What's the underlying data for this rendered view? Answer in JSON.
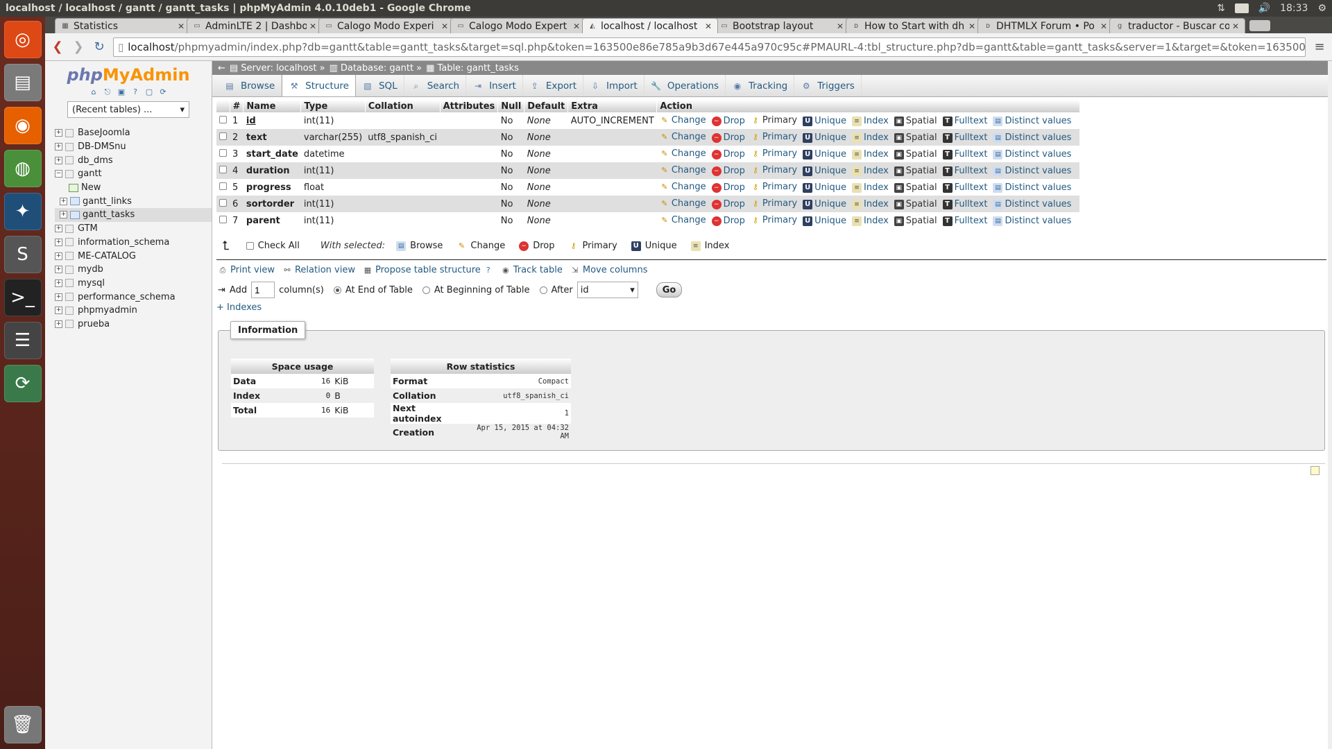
{
  "window_title": "localhost / localhost / gantt / gantt_tasks | phpMyAdmin 4.0.10deb1 - Google Chrome",
  "os_tray": {
    "keyboard": "Es",
    "time": "18:33"
  },
  "tabs": [
    {
      "label": "Statistics",
      "fav": "▦"
    },
    {
      "label": "AdminLTE 2 | Dashbo",
      "fav": "▭"
    },
    {
      "label": "Calogo Modo Experi",
      "fav": "▭"
    },
    {
      "label": "Calogo Modo Expert",
      "fav": "▭"
    },
    {
      "label": "localhost / localhost",
      "fav": "◭",
      "active": true
    },
    {
      "label": "Bootstrap layout",
      "fav": "▭"
    },
    {
      "label": "How to Start with dh",
      "fav": "ᴅ"
    },
    {
      "label": "DHTMLX Forum • Po",
      "fav": "ᴅ"
    },
    {
      "label": "traductor - Buscar co",
      "fav": "g"
    }
  ],
  "url": {
    "host": "localhost",
    "rest": "/phpmyadmin/index.php?db=gantt&table=gantt_tasks&target=sql.php&token=163500e86e785a9b3d67e445a970c95c#PMAURL-4:tbl_structure.php?db=gantt&table=gantt_tasks&server=1&target=&token=163500e86e785a9b3"
  },
  "logo": {
    "php": "php",
    "my": "My",
    "admin": "Admin"
  },
  "recent_tables": "(Recent tables) ...",
  "tree": {
    "dbs_before": [
      "BaseJoomla",
      "DB-DMSnu",
      "db_dms"
    ],
    "gantt": "gantt",
    "gantt_children": [
      "New",
      "gantt_links",
      "gantt_tasks"
    ],
    "dbs_after": [
      "GTM",
      "information_schema",
      "ME-CATALOG",
      "mydb",
      "mysql",
      "performance_schema",
      "phpmyadmin",
      "prueba"
    ]
  },
  "breadcrumb": {
    "server": "Server: localhost »",
    "database": "Database: gantt »",
    "table": "Table: gantt_tasks"
  },
  "menu": [
    "Browse",
    "Structure",
    "SQL",
    "Search",
    "Insert",
    "Export",
    "Import",
    "Operations",
    "Tracking",
    "Triggers"
  ],
  "menu_active": "Structure",
  "columns_header": [
    "#",
    "Name",
    "Type",
    "Collation",
    "Attributes",
    "Null",
    "Default",
    "Extra",
    "Action"
  ],
  "columns": [
    {
      "n": "1",
      "name": "id",
      "type": "int(11)",
      "collation": "",
      "attributes": "",
      "null": "No",
      "default": "None",
      "extra": "AUTO_INCREMENT",
      "pk": true
    },
    {
      "n": "2",
      "name": "text",
      "type": "varchar(255)",
      "collation": "utf8_spanish_ci",
      "attributes": "",
      "null": "No",
      "default": "None",
      "extra": ""
    },
    {
      "n": "3",
      "name": "start_date",
      "type": "datetime",
      "collation": "",
      "attributes": "",
      "null": "No",
      "default": "None",
      "extra": ""
    },
    {
      "n": "4",
      "name": "duration",
      "type": "int(11)",
      "collation": "",
      "attributes": "",
      "null": "No",
      "default": "None",
      "extra": ""
    },
    {
      "n": "5",
      "name": "progress",
      "type": "float",
      "collation": "",
      "attributes": "",
      "null": "No",
      "default": "None",
      "extra": ""
    },
    {
      "n": "6",
      "name": "sortorder",
      "type": "int(11)",
      "collation": "",
      "attributes": "",
      "null": "No",
      "default": "None",
      "extra": ""
    },
    {
      "n": "7",
      "name": "parent",
      "type": "int(11)",
      "collation": "",
      "attributes": "",
      "null": "No",
      "default": "None",
      "extra": ""
    }
  ],
  "row_actions": [
    "Change",
    "Drop",
    "Primary",
    "Unique",
    "Index",
    "Spatial",
    "Fulltext",
    "Distinct values"
  ],
  "with_selected": {
    "check_all": "Check All",
    "label": "With selected:",
    "buttons": [
      "Browse",
      "Change",
      "Drop",
      "Primary",
      "Unique",
      "Index"
    ]
  },
  "links": [
    "Print view",
    "Relation view",
    "Propose table structure",
    "Track table",
    "Move columns"
  ],
  "add_row": {
    "add": "Add",
    "count": "1",
    "columns": "column(s)",
    "end": "At End of Table",
    "begin": "At Beginning of Table",
    "after": "After",
    "after_value": "id",
    "go": "Go"
  },
  "indexes_link": "+ Indexes",
  "information": {
    "legend": "Information",
    "space": {
      "title": "Space usage",
      "rows": [
        [
          "Data",
          "16",
          "KiB"
        ],
        [
          "Index",
          "0",
          "B"
        ],
        [
          "Total",
          "16",
          "KiB"
        ]
      ]
    },
    "rowstats": {
      "title": "Row statistics",
      "rows": [
        [
          "Format",
          "Compact"
        ],
        [
          "Collation",
          "utf8_spanish_ci"
        ],
        [
          "Next autoindex",
          "1"
        ],
        [
          "Creation",
          "Apr 15, 2015 at 04:32 AM"
        ]
      ]
    }
  }
}
